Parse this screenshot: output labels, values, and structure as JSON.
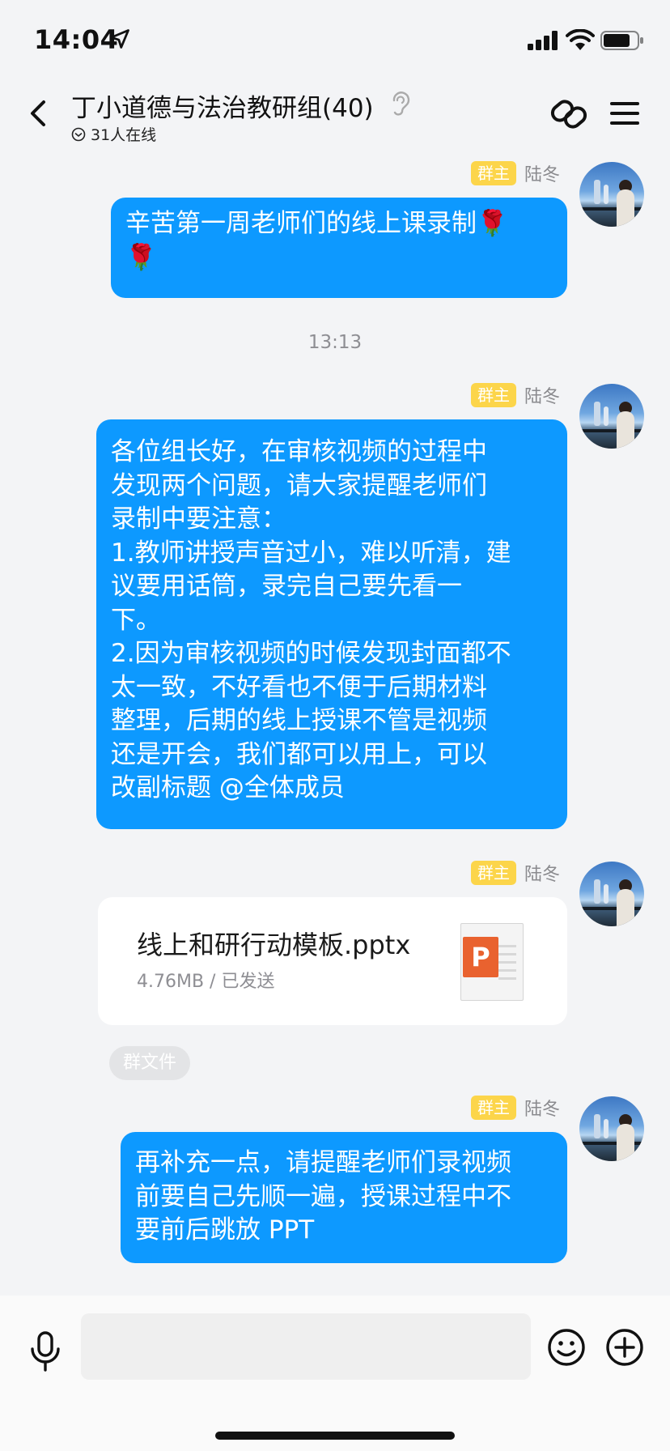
{
  "status_bar": {
    "time": "14:04",
    "icons": [
      "location-arrow-icon",
      "cellular-signal-icon",
      "wifi-icon",
      "battery-icon"
    ]
  },
  "header": {
    "title": "丁小道德与法治教研组(40)",
    "online_count": "31人在线",
    "icons": [
      "back-icon",
      "ear-icon",
      "link-icon",
      "menu-icon"
    ]
  },
  "messages": [
    {
      "badge": "群主",
      "sender": "陆冬",
      "text": "辛苦第一周老师们的线上课录制🌹\n🌹"
    },
    {
      "timestamp": "13:13"
    },
    {
      "badge": "群主",
      "sender": "陆冬",
      "text": "各位组长好，在审核视频的过程中\n发现两个问题，请大家提醒老师们\n录制中要注意：\n1.教师讲授声音过小，难以听清，建\n议要用话筒，录完自己要先看一\n下。\n2.因为审核视频的时候发现封面都不\n太一致，不好看也不便于后期材料\n整理，后期的线上授课不管是视频\n还是开会，我们都可以用上，可以\n改副标题 @全体成员"
    },
    {
      "badge": "群主",
      "sender": "陆冬",
      "file": {
        "name": "线上和研行动模板.pptx",
        "meta": "4.76MB / 已发送",
        "icon_letter": "P"
      },
      "tag": "群文件"
    },
    {
      "badge": "群主",
      "sender": "陆冬",
      "text": "再补充一点，请提醒老师们录视频\n前要自己先顺一遍，授课过程中不\n要前后跳放 PPT"
    }
  ],
  "input_bar": {
    "placeholder": "",
    "icons": [
      "microphone-icon",
      "emoji-icon",
      "plus-icon"
    ]
  },
  "colors": {
    "bubble": "#0d99ff",
    "badge": "#fcd54a",
    "background": "#f3f4f6"
  }
}
